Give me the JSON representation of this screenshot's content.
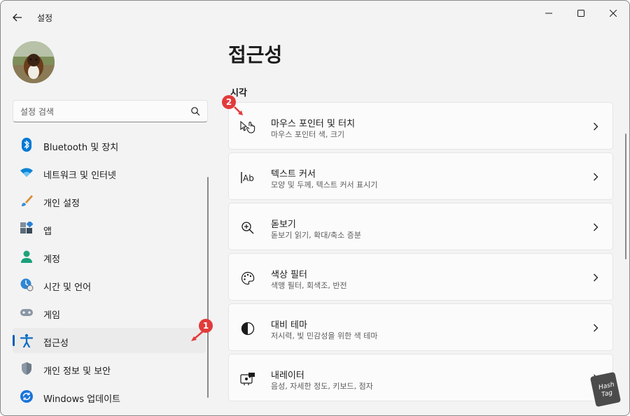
{
  "window": {
    "app_title": "설정",
    "controls": {
      "minimize": "minimize-icon",
      "maximize": "maximize-icon",
      "close": "close-icon"
    }
  },
  "sidebar": {
    "search_placeholder": "설정 검색",
    "items": [
      {
        "label": "Bluetooth 및 장치",
        "icon": "bluetooth-icon"
      },
      {
        "label": "네트워크 및 인터넷",
        "icon": "wifi-icon"
      },
      {
        "label": "개인 설정",
        "icon": "brush-icon"
      },
      {
        "label": "앱",
        "icon": "apps-icon"
      },
      {
        "label": "계정",
        "icon": "account-icon"
      },
      {
        "label": "시간 및 언어",
        "icon": "time-language-icon"
      },
      {
        "label": "게임",
        "icon": "gamepad-icon"
      },
      {
        "label": "접근성",
        "icon": "accessibility-icon",
        "active": true
      },
      {
        "label": "개인 정보 및 보안",
        "icon": "shield-icon"
      },
      {
        "label": "Windows 업데이트",
        "icon": "update-icon"
      }
    ]
  },
  "main": {
    "page_title": "접근성",
    "section_title": "시각",
    "cards": [
      {
        "title": "마우스 포인터 및 터치",
        "subtitle": "마우스 포인터 색, 크기",
        "icon": "mouse-pointer-icon"
      },
      {
        "title": "텍스트 커서",
        "subtitle": "모양 및 두께, 텍스트 커서 표시기",
        "icon": "text-cursor-icon"
      },
      {
        "title": "돋보기",
        "subtitle": "돋보기 읽기, 확대/축소 증분",
        "icon": "magnifier-icon"
      },
      {
        "title": "색상 필터",
        "subtitle": "색맹 필터, 회색조, 반전",
        "icon": "palette-icon"
      },
      {
        "title": "대비 테마",
        "subtitle": "저시력, 빛 민감성을 위한 색 테마",
        "icon": "contrast-icon"
      },
      {
        "title": "내레이터",
        "subtitle": "음성, 자세한 정도, 키보드, 점자",
        "icon": "narrator-icon"
      }
    ]
  },
  "annotations": {
    "badge1": "1",
    "badge2": "2"
  },
  "colors": {
    "accent": "#005fb8",
    "annotation": "#e23b3b"
  }
}
